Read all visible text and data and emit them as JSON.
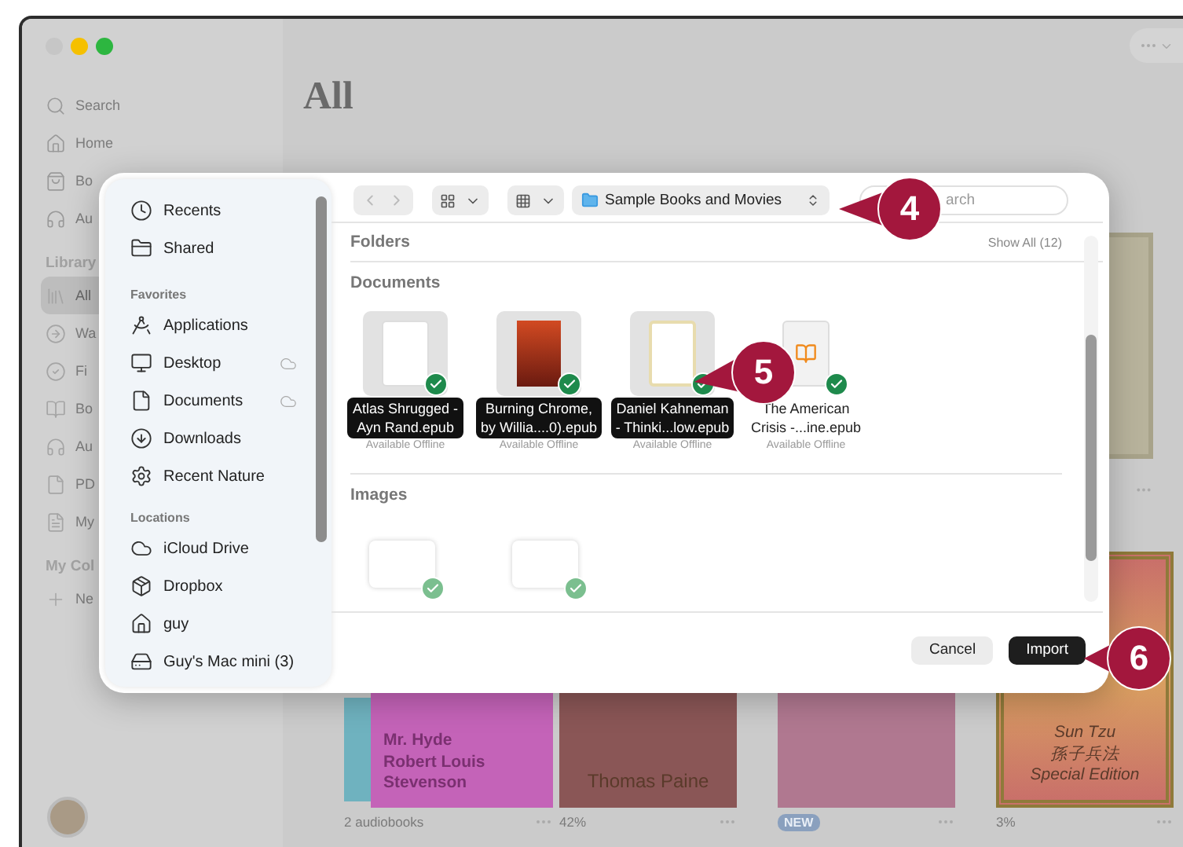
{
  "app": {
    "sidebar": {
      "top_items": [
        {
          "label": "Search"
        },
        {
          "label": "Home"
        },
        {
          "label": "Bo"
        },
        {
          "label": "Au"
        }
      ],
      "library_heading": "Library",
      "library_items": [
        {
          "label": "All",
          "selected": true
        },
        {
          "label": "Wa",
          "selected": false
        },
        {
          "label": "Fi",
          "selected": false
        },
        {
          "label": "Bo",
          "selected": false
        },
        {
          "label": "Au",
          "selected": false
        },
        {
          "label": "PD",
          "selected": false
        },
        {
          "label": "My",
          "selected": false
        }
      ],
      "collections_heading": "My Col",
      "new_collection": "Ne"
    },
    "title": "All",
    "books": [
      {
        "kind": "audiobook",
        "color": "#c463b8",
        "cover_lines": [
          "Mr. Hyde",
          "Robert Louis",
          "Stevenson"
        ],
        "caption": "2 audiobooks"
      },
      {
        "kind": "plain",
        "color": "#8a5656",
        "cover_lines": [
          "Thomas Paine"
        ],
        "caption": "42%"
      },
      {
        "kind": "photo",
        "color": "#b07890",
        "badge": "NEW"
      },
      {
        "kind": "framed",
        "color": "#c9706a",
        "cover_lines": [
          "Sun Tzu",
          "孫子兵法",
          "Special Edition"
        ],
        "caption": "3%"
      }
    ]
  },
  "dialog": {
    "sidebar": [
      {
        "items": [
          {
            "label": "Recents",
            "cloud": false
          },
          {
            "label": "Shared",
            "cloud": false
          }
        ]
      },
      {
        "heading": "Favorites",
        "items": [
          {
            "label": "Applications",
            "cloud": false
          },
          {
            "label": "Desktop",
            "cloud": true
          },
          {
            "label": "Documents",
            "cloud": true
          },
          {
            "label": "Downloads",
            "cloud": false
          },
          {
            "label": "Recent Nature",
            "cloud": false
          }
        ]
      },
      {
        "heading": "Locations",
        "items": [
          {
            "label": "iCloud Drive",
            "cloud": false
          },
          {
            "label": "Dropbox",
            "cloud": false
          },
          {
            "label": "guy",
            "cloud": false
          },
          {
            "label": "Guy's Mac mini (3)",
            "cloud": false
          }
        ]
      }
    ],
    "location": "Sample Books and Movies",
    "search_placeholder": "arch",
    "folders": {
      "title": "Folders",
      "show_all": "Show All (12)"
    },
    "documents": {
      "title": "Documents",
      "files": [
        {
          "kind": "page",
          "name": "Atlas Shrugged -\nAyn Rand.epub",
          "status": "Available Offline",
          "selected": true
        },
        {
          "kind": "photo",
          "name": "Burning Chrome,\nby Willia....0).epub",
          "status": "Available Offline",
          "selected": true
        },
        {
          "kind": "cream",
          "name": "Daniel Kahneman\n- Thinki...low.epub",
          "status": "Available Offline",
          "selected": true
        },
        {
          "kind": "epub",
          "name": "The American\nCrisis -...ine.epub",
          "status": "Available Offline",
          "selected": false
        }
      ]
    },
    "images": {
      "title": "Images",
      "items": [
        {
          "kind": "blank"
        },
        {
          "kind": "blank"
        }
      ]
    },
    "buttons": {
      "cancel": "Cancel",
      "import": "Import"
    }
  },
  "callouts": [
    {
      "number": "4"
    },
    {
      "number": "5"
    },
    {
      "number": "6"
    }
  ]
}
